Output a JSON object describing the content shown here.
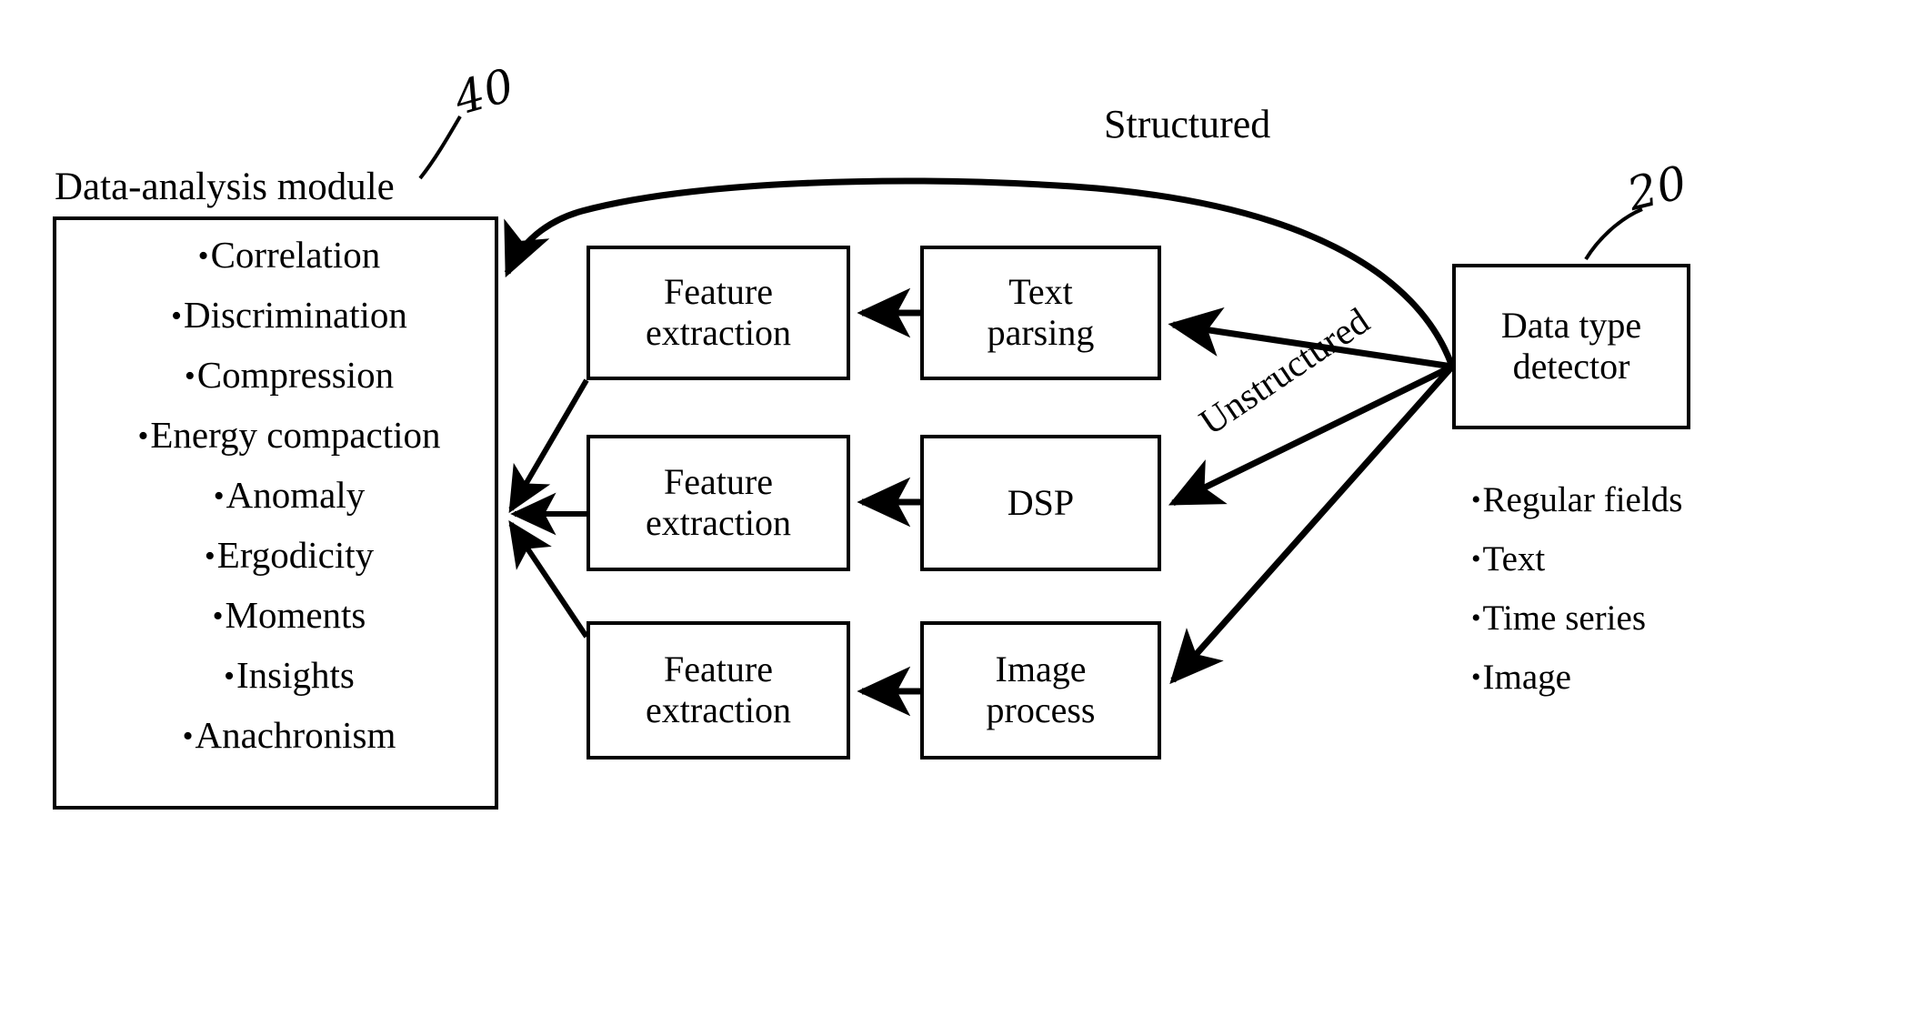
{
  "figure": {
    "type": "patent-block-diagram",
    "reference_numerals": [
      {
        "id": "ref-40",
        "value": "40",
        "points_to": "data-analysis-module"
      },
      {
        "id": "ref-20",
        "value": "20",
        "points_to": "data-type-detector"
      }
    ]
  },
  "module": {
    "title": "Data-analysis module",
    "items": [
      "Correlation",
      "Discrimination",
      "Compression",
      "Energy compaction",
      "Anomaly",
      "Ergodicity",
      "Moments",
      "Insights",
      "Anachronism"
    ]
  },
  "pipelines": [
    {
      "feature_line1": "Feature",
      "feature_line2": "extraction",
      "processor_line1": "Text",
      "processor_line2": "parsing"
    },
    {
      "feature_line1": "Feature",
      "feature_line2": "extraction",
      "processor_line1": "DSP",
      "processor_line2": ""
    },
    {
      "feature_line1": "Feature",
      "feature_line2": "extraction",
      "processor_line1": "Image",
      "processor_line2": "process"
    }
  ],
  "detector": {
    "title_line1": "Data type",
    "title_line2": "detector",
    "data_types": [
      "Regular fields",
      "Text",
      "Time series",
      "Image"
    ]
  },
  "edge_labels": {
    "structured": "Structured",
    "unstructured": "Unstructured"
  },
  "colors": {
    "ink": "#000000",
    "paper": "#ffffff"
  }
}
